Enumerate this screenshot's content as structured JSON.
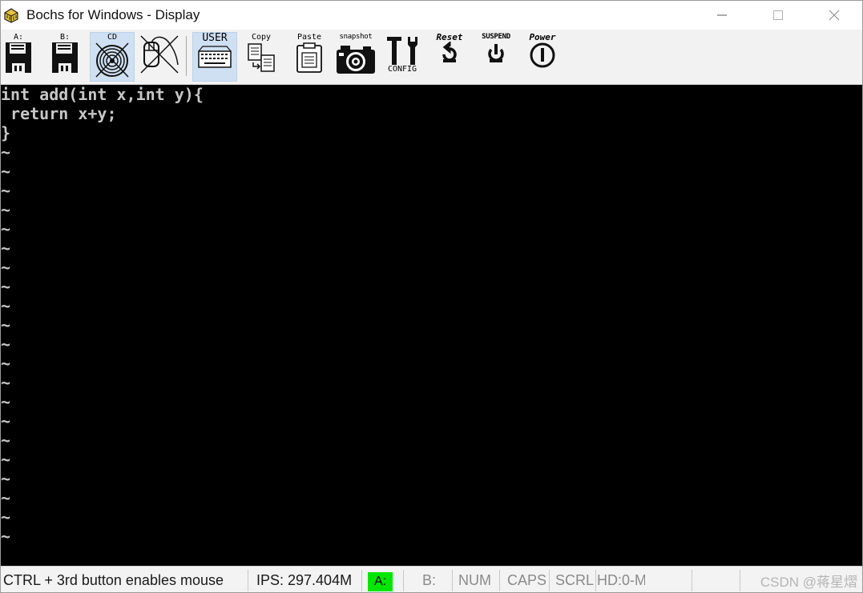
{
  "window": {
    "title": "Bochs for Windows - Display",
    "app_icon": "bochs-app-icon"
  },
  "titlebar_controls": {
    "minimize_icon": "minimize-icon",
    "maximize_icon": "maximize-icon",
    "close_icon": "close-icon"
  },
  "toolbar": {
    "floppy_a": "A:",
    "floppy_b": "B:",
    "cdrom": "CD",
    "user": "USER",
    "copy": "Copy",
    "paste": "Paste",
    "snapshot": "snapshot",
    "config": "CONFIG",
    "reset": "Reset",
    "suspend": "SUSPEND",
    "power": "Power"
  },
  "screen": {
    "lines": [
      "int add(int x,int y){",
      " return x+y;",
      "}"
    ],
    "tilde": "~",
    "tilde_rows": 21
  },
  "statusbar": {
    "message": "CTRL + 3rd button enables mouse",
    "ips": "IPS: 297.404M",
    "floppy_a": "A:",
    "floppy_b": "B:",
    "num": "NUM",
    "caps": "CAPS",
    "scrl": "SCRL",
    "hd": "HD:0-M",
    "led_color": "#00e600"
  },
  "watermark": "CSDN @蒋星熠"
}
